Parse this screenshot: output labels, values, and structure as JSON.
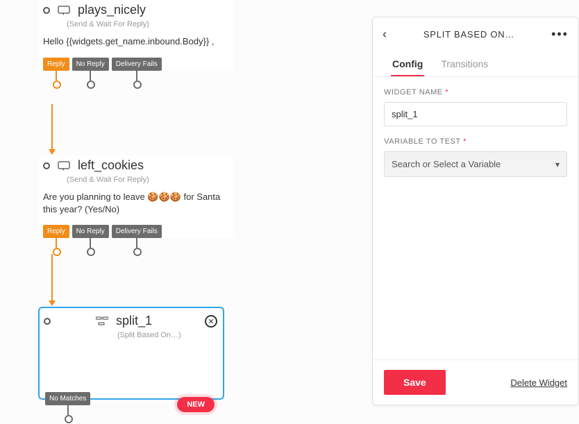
{
  "canvas": {
    "widgets": [
      {
        "id": "w1",
        "title": "plays_nicely",
        "subtitle": "(Send & Wait For Reply)",
        "body": "Hello {{widgets.get_name.inbound.Body}} ,",
        "pills": [
          "Reply",
          "No Reply",
          "Delivery Fails"
        ],
        "icon": "chat-icon"
      },
      {
        "id": "w2",
        "title": "left_cookies",
        "subtitle": "(Send & Wait For Reply)",
        "body": "Are you planning to leave 🍪🍪🍪 for Santa this year? (Yes/No)",
        "pills": [
          "Reply",
          "No Reply",
          "Delivery Fails"
        ],
        "icon": "chat-icon"
      },
      {
        "id": "w3",
        "title": "split_1",
        "subtitle": "(Split Based On…)",
        "pills_left": "No Matches",
        "pills_right": "NEW",
        "icon": "split-icon",
        "selected": true
      }
    ]
  },
  "panel": {
    "title": "SPLIT BASED ON…",
    "tabs": {
      "config": "Config",
      "transitions": "Transitions"
    },
    "widget_name_label": "WIDGET NAME",
    "widget_name_value": "split_1",
    "variable_label": "VARIABLE TO TEST",
    "variable_placeholder": "Search or Select a Variable",
    "save_label": "Save",
    "delete_label": "Delete Widget"
  }
}
